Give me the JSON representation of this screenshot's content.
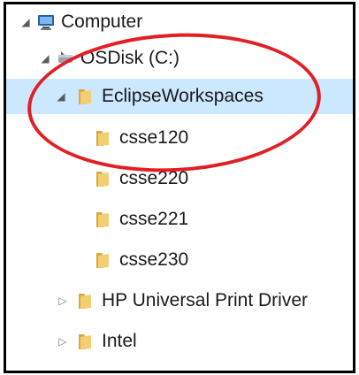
{
  "tree": {
    "computer": {
      "label": "Computer",
      "icon": "computer-icon",
      "expanded": true
    },
    "drive": {
      "label": "OSDisk (C:)",
      "icon": "drive-icon",
      "expanded": true
    },
    "workspaces": {
      "label": "EclipseWorkspaces",
      "icon": "folder-icon",
      "expanded": true,
      "selected": true
    },
    "children": [
      {
        "label": "csse120",
        "icon": "folder-icon"
      },
      {
        "label": "csse220",
        "icon": "folder-icon"
      },
      {
        "label": "csse221",
        "icon": "folder-icon"
      },
      {
        "label": "csse230",
        "icon": "folder-icon"
      }
    ],
    "siblings": [
      {
        "label": "HP Universal Print Driver",
        "icon": "folder-icon",
        "expanded": false
      },
      {
        "label": "Intel",
        "icon": "folder-icon",
        "expanded": false
      }
    ]
  },
  "colors": {
    "annotation": "#e11f26",
    "selection": "#cce8ff",
    "folder": "#e6c25a"
  }
}
